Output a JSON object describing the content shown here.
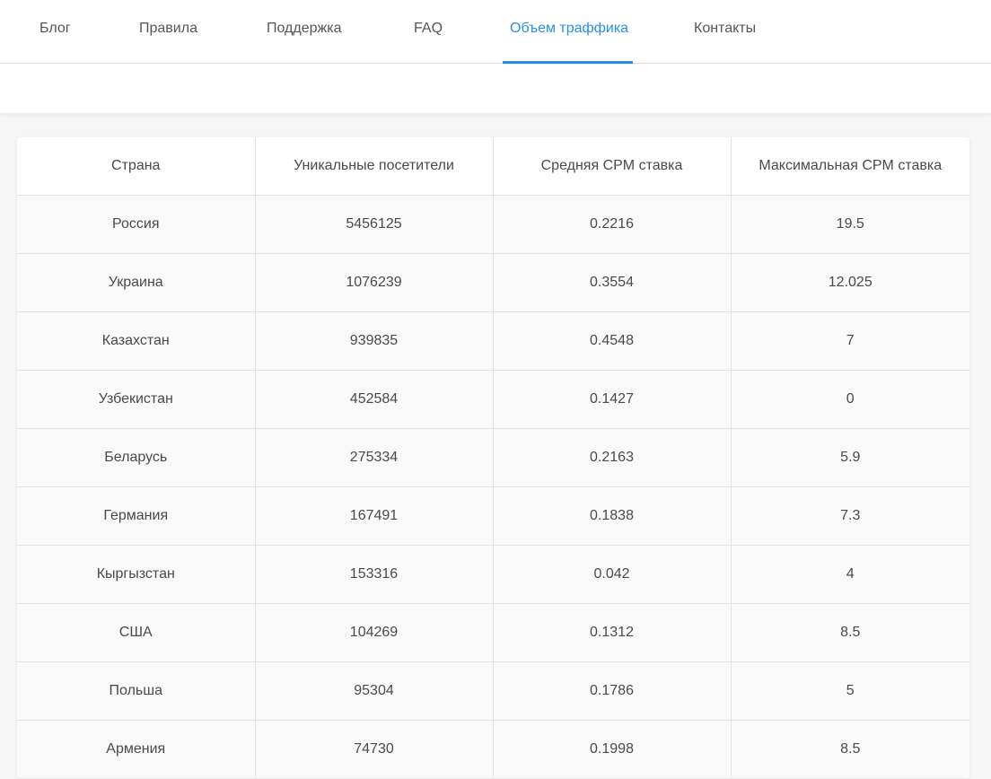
{
  "nav": {
    "items": [
      {
        "label": "Блог"
      },
      {
        "label": "Правила"
      },
      {
        "label": "Поддержка"
      },
      {
        "label": "FAQ"
      },
      {
        "label": "Объем траффика"
      },
      {
        "label": "Контакты"
      }
    ],
    "active_index": 4,
    "accent_color": "#2a8ee8"
  },
  "table": {
    "headers": [
      "Страна",
      "Уникальные посетители",
      "Средняя CPM ставка",
      "Максимальная CPM ставка"
    ],
    "rows": [
      [
        "Россия",
        "5456125",
        "0.2216",
        "19.5"
      ],
      [
        "Украина",
        "1076239",
        "0.3554",
        "12.025"
      ],
      [
        "Казахстан",
        "939835",
        "0.4548",
        "7"
      ],
      [
        "Узбекистан",
        "452584",
        "0.1427",
        "0"
      ],
      [
        "Беларусь",
        "275334",
        "0.2163",
        "5.9"
      ],
      [
        "Германия",
        "167491",
        "0.1838",
        "7.3"
      ],
      [
        "Кыргызстан",
        "153316",
        "0.042",
        "4"
      ],
      [
        "США",
        "104269",
        "0.1312",
        "8.5"
      ],
      [
        "Польша",
        "95304",
        "0.1786",
        "5"
      ],
      [
        "Армения",
        "74730",
        "0.1998",
        "8.5"
      ]
    ]
  }
}
